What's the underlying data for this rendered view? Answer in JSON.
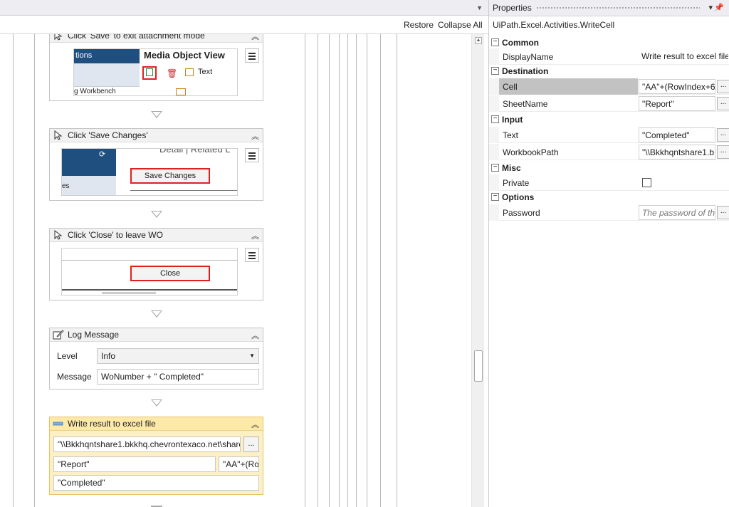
{
  "designer": {
    "toolbar": {
      "restore": "Restore",
      "collapse_all": "Collapse All"
    },
    "activities": [
      {
        "title": "Click 'Save' to exit attachment mode",
        "thumb": {
          "header_left": "tions",
          "header_right": "Media Object View",
          "item_text": "Text",
          "bottom_left": "g Workbench"
        }
      },
      {
        "title": "Click 'Save Changes'",
        "thumb": {
          "top_text": "Detail | Related L",
          "button": "Save Changes",
          "side_text": "es"
        }
      },
      {
        "title": "Click 'Close' to leave WO",
        "thumb": {
          "button": "Close"
        }
      },
      {
        "title": "Log Message",
        "level_label": "Level",
        "level_value": "Info",
        "message_label": "Message",
        "message_value": "WoNumber + \" Completed\""
      },
      {
        "title": "Write result to excel file",
        "path_value": "\"\\\\Bkkhqntshare1.bkkhq.chevrontexaco.net\\share",
        "sheet_value": "\"Report\"",
        "cell_value": "\"AA\"+(Ro",
        "text_value": "\"Completed\"",
        "ellipsis": "..."
      }
    ]
  },
  "properties": {
    "title": "Properties",
    "activity_type": "UiPath.Excel.Activities.WriteCell",
    "categories": [
      {
        "name": "Common",
        "rows": [
          {
            "name": "DisplayName",
            "value": "Write result to excel file"
          }
        ]
      },
      {
        "name": "Destination",
        "rows": [
          {
            "name": "Cell",
            "value": "\"AA\"+(RowIndex+6"
          },
          {
            "name": "SheetName",
            "value": "\"Report\""
          }
        ]
      },
      {
        "name": "Input",
        "rows": [
          {
            "name": "Text",
            "value": "\"Completed\""
          },
          {
            "name": "WorkbookPath",
            "value": "\"\\\\Bkkhqntshare1.b"
          }
        ]
      },
      {
        "name": "Misc",
        "rows": [
          {
            "name": "Private",
            "value": ""
          }
        ]
      },
      {
        "name": "Options",
        "rows": [
          {
            "name": "Password",
            "placeholder": "The password of the"
          }
        ]
      }
    ],
    "ellipsis": "...",
    "collapse_glyph": "−"
  },
  "icons": {
    "click": "cursor-arrow-icon",
    "log": "log-message-icon",
    "write": "write-cell-icon",
    "collapse": "collapse-chevron-icon",
    "menu": "hamburger-icon"
  },
  "colors": {
    "selected_activity_bg": "#fdf0c2",
    "selected_activity_border": "#e8c26a",
    "highlight_red": "#e02020"
  }
}
